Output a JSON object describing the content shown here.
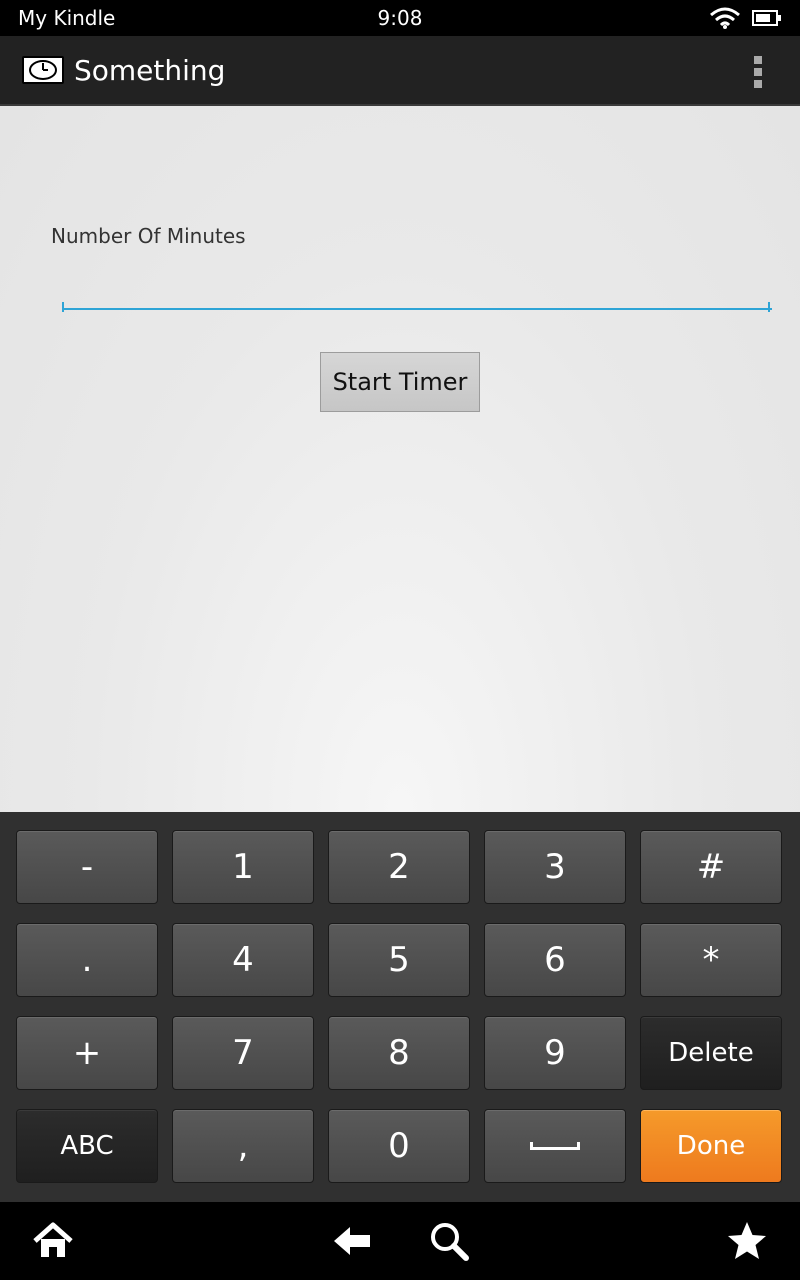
{
  "status_bar": {
    "carrier": "My Kindle",
    "time": "9:08"
  },
  "action_bar": {
    "title": "Something",
    "app_icon": "clock-icon",
    "overflow_icon": "overflow-menu-icon"
  },
  "form": {
    "label": "Number Of Minutes",
    "input_value": "",
    "button_label": "Start Timer"
  },
  "keypad": {
    "row1": [
      "-",
      "1",
      "2",
      "3",
      "#"
    ],
    "row2": [
      ".",
      "4",
      "5",
      "6",
      "*"
    ],
    "row3": [
      "+",
      "7",
      "8",
      "9",
      "Delete"
    ],
    "row4": [
      "ABC",
      ",",
      "0",
      "space",
      "Done"
    ],
    "done_color": "#f18a22"
  },
  "nav_bar": {
    "icons": [
      "home-icon",
      "back-icon",
      "search-icon",
      "favorites-icon"
    ]
  }
}
